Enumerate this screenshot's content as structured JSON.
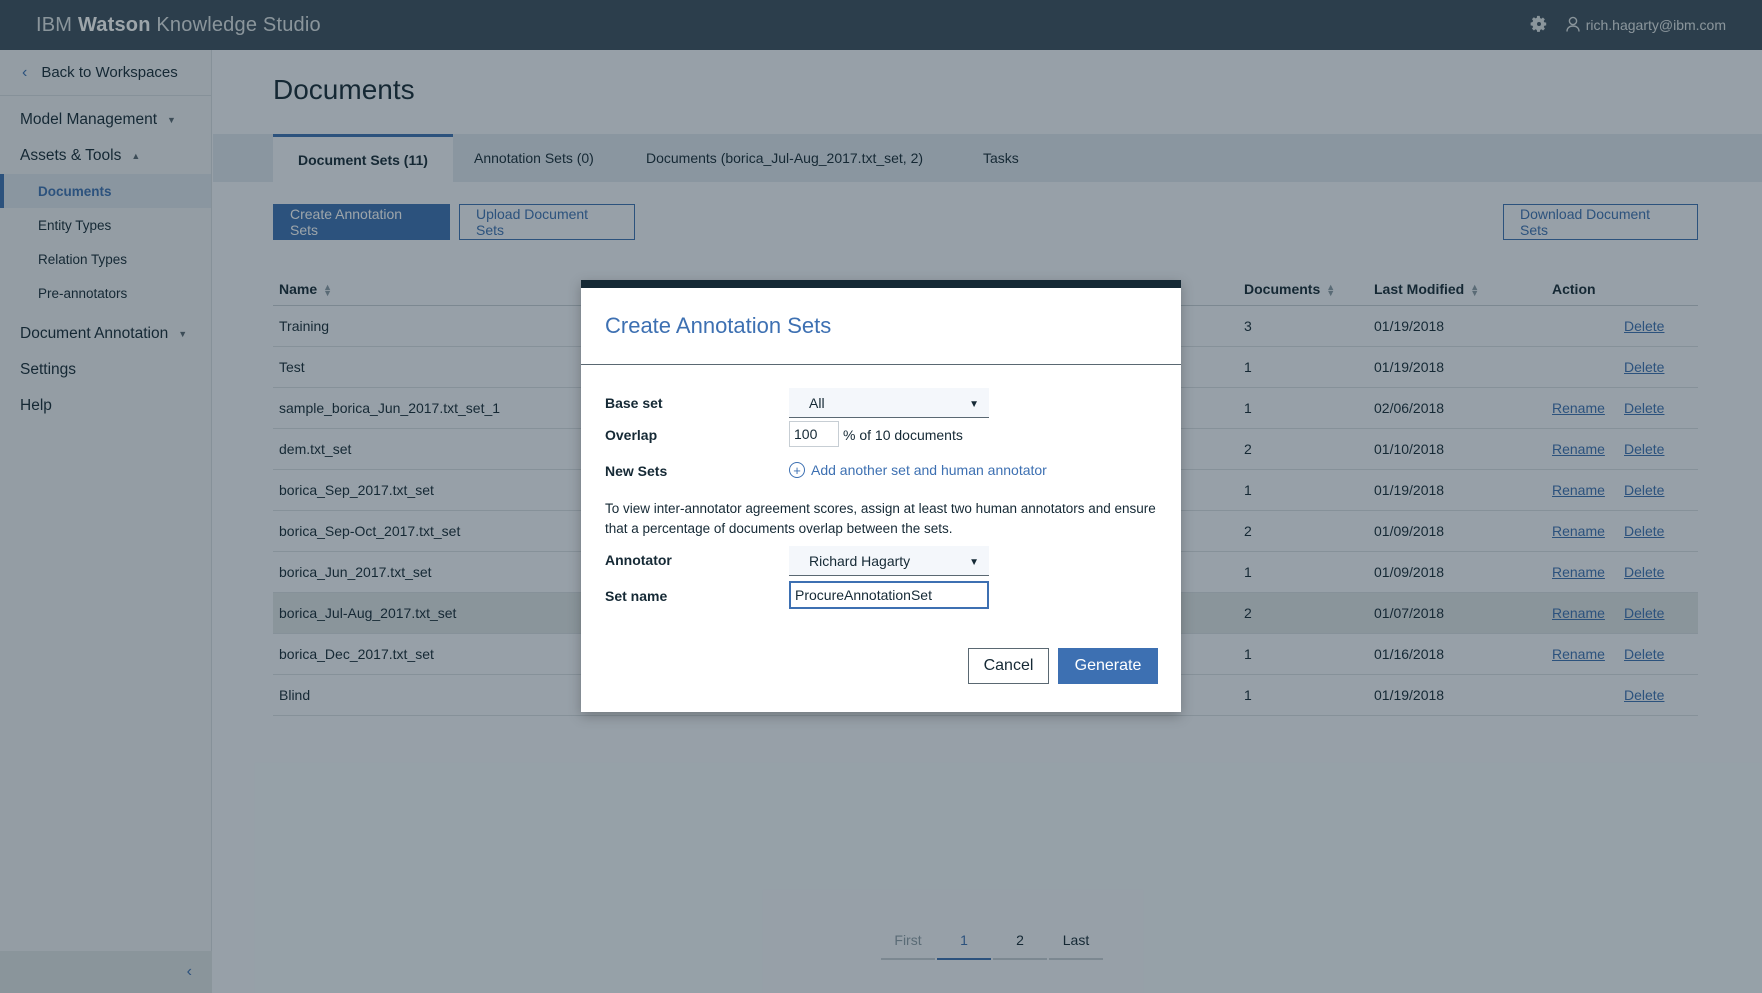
{
  "header": {
    "brand_prefix": "IBM",
    "brand_bold": "Watson",
    "brand_suffix": "Knowledge Studio",
    "user_email": "rich.hagarty@ibm.com"
  },
  "sidebar": {
    "back_label": "Back to Workspaces",
    "groups": [
      {
        "label": "Model Management"
      },
      {
        "label": "Assets & Tools"
      },
      {
        "label": "Document Annotation"
      },
      {
        "label": "Settings"
      },
      {
        "label": "Help"
      }
    ],
    "sub_items": [
      {
        "label": "Documents",
        "active": true
      },
      {
        "label": "Entity Types"
      },
      {
        "label": "Relation Types"
      },
      {
        "label": "Pre-annotators"
      }
    ]
  },
  "main": {
    "title": "Documents",
    "tabs": [
      {
        "label": "Document Sets (11)",
        "active": true
      },
      {
        "label": "Annotation Sets (0)"
      },
      {
        "label": "Documents (borica_Jul-Aug_2017.txt_set, 2)"
      },
      {
        "label": "Tasks"
      }
    ],
    "buttons": {
      "create": "Create Annotation Sets",
      "upload": "Upload Document Sets",
      "download": "Download Document Sets"
    }
  },
  "table": {
    "columns": {
      "name": "Name",
      "documents": "Documents",
      "last_modified": "Last Modified",
      "action": "Action"
    },
    "rename_label": "Rename",
    "delete_label": "Delete",
    "rows": [
      {
        "name": "Training",
        "documents": "3",
        "modified": "01/19/2018"
      },
      {
        "name": "Test",
        "documents": "1",
        "modified": "01/19/2018"
      },
      {
        "name": "sample_borica_Jun_2017.txt_set_1",
        "documents": "1",
        "modified": "02/06/2018"
      },
      {
        "name": "dem.txt_set",
        "documents": "2",
        "modified": "01/10/2018"
      },
      {
        "name": "borica_Sep_2017.txt_set",
        "documents": "1",
        "modified": "01/19/2018"
      },
      {
        "name": "borica_Sep-Oct_2017.txt_set",
        "documents": "2",
        "modified": "01/09/2018"
      },
      {
        "name": "borica_Jun_2017.txt_set",
        "documents": "1",
        "modified": "01/09/2018"
      },
      {
        "name": "borica_Jul-Aug_2017.txt_set",
        "documents": "2",
        "modified": "01/07/2018"
      },
      {
        "name": "borica_Dec_2017.txt_set",
        "documents": "1",
        "modified": "01/16/2018"
      },
      {
        "name": "Blind",
        "documents": "1",
        "modified": "01/19/2018"
      }
    ]
  },
  "pagination": {
    "first": "First",
    "page1": "1",
    "page2": "2",
    "last": "Last"
  },
  "modal": {
    "title": "Create Annotation Sets",
    "base_set_label": "Base set",
    "base_set_value": "All",
    "overlap_label": "Overlap",
    "overlap_value": "100",
    "overlap_suffix": "% of 10 documents",
    "new_sets_label": "New Sets",
    "add_link": "Add another set and human annotator",
    "help_text": "To view inter-annotator agreement scores, assign at least two human annotators and ensure that a percentage of documents overlap between the sets.",
    "annotator_label": "Annotator",
    "annotator_value": "Richard Hagarty",
    "set_name_label": "Set name",
    "set_name_value": "ProcureAnnotationSet",
    "cancel": "Cancel",
    "generate": "Generate"
  },
  "colors": {
    "accent": "#3d70b2",
    "header_bg": "#3d4f5e",
    "modal_border": "#152935"
  }
}
